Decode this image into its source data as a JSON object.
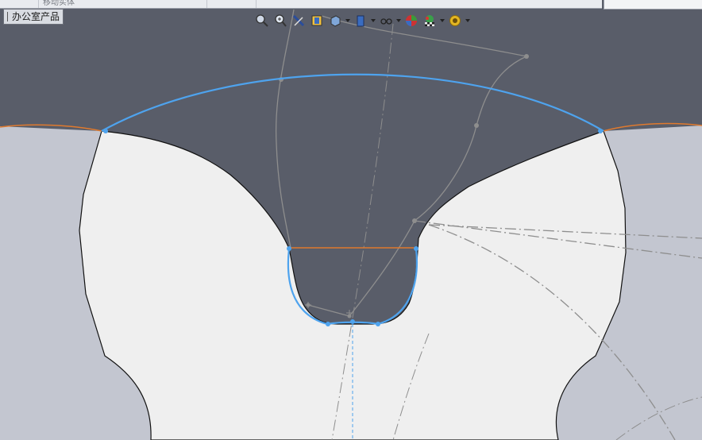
{
  "window": {
    "tab_label": "办公室产品",
    "ribbon_hint": "移动实体"
  },
  "hud_toolbar": {
    "buttons": [
      {
        "icon": "zoom-to-fit-icon",
        "has_dropdown": false
      },
      {
        "icon": "zoom-to-area-icon",
        "has_dropdown": false
      },
      {
        "icon": "previous-view-icon",
        "has_dropdown": false
      },
      {
        "icon": "section-view-icon",
        "has_dropdown": false
      },
      {
        "icon": "view-orientation-icon",
        "has_dropdown": true
      },
      {
        "icon": "display-style-icon",
        "has_dropdown": true
      },
      {
        "icon": "hide-show-items-icon",
        "has_dropdown": true
      },
      {
        "icon": "edit-appearance-icon",
        "has_dropdown": false
      },
      {
        "icon": "apply-scene-icon",
        "has_dropdown": true
      },
      {
        "icon": "view-settings-icon",
        "has_dropdown": true
      }
    ]
  },
  "colors": {
    "viewport_bg": "#595d69",
    "part_face": "#efefef",
    "side_face": "#c3c6d0",
    "sketch_blue": "#4ea3ee",
    "sketch_orange": "#e07a2e",
    "construction_gray": "#8e8e8e"
  }
}
